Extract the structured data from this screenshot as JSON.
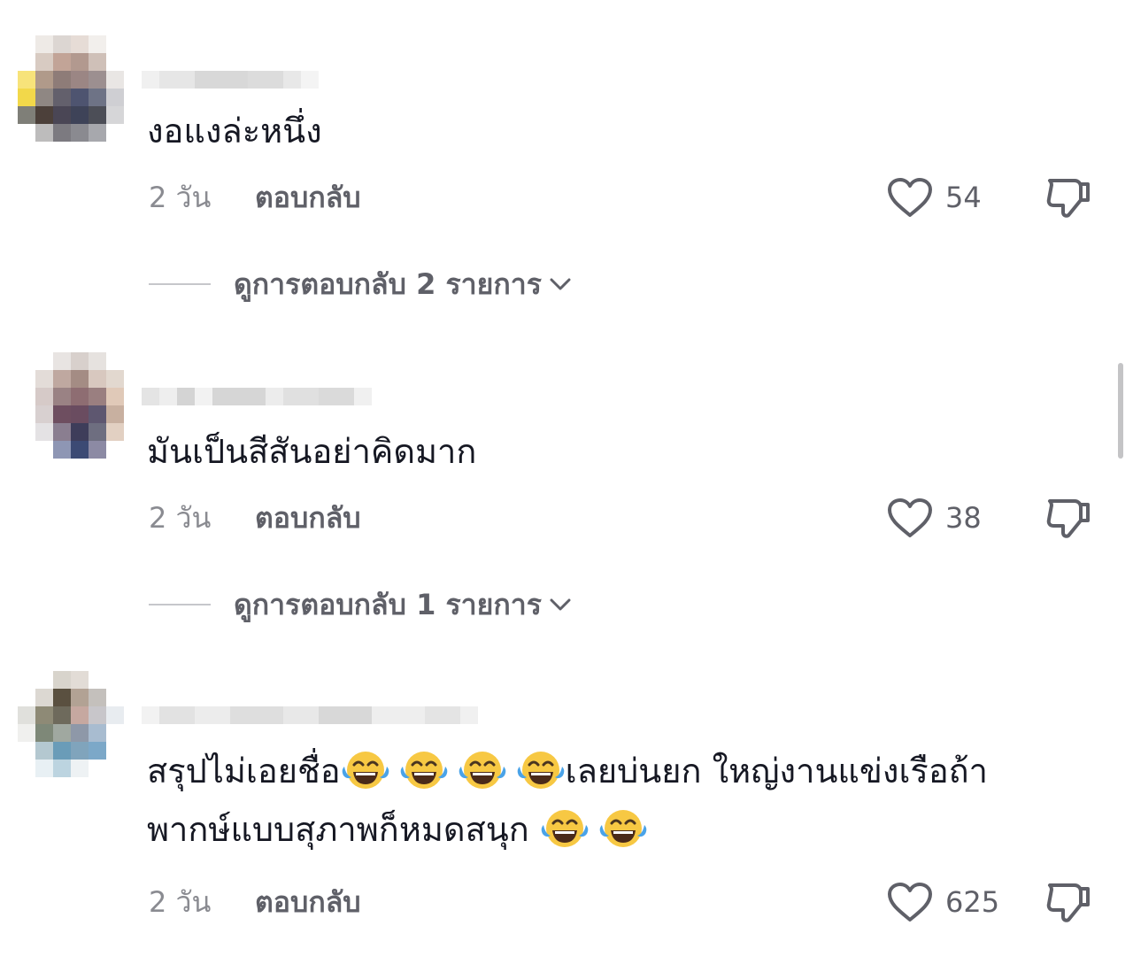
{
  "comments": [
    {
      "text": "งอแงล่ะหนึ่ง",
      "time": "2 วัน",
      "reply_label": "ตอบกลับ",
      "likes": "54",
      "view_replies": "ดูการตอบกลับ 2 รายการ"
    },
    {
      "text": "มันเป็นสีสันอย่าคิดมาก",
      "time": "2 วัน",
      "reply_label": "ตอบกลับ",
      "likes": "38",
      "view_replies": "ดูการตอบกลับ 1 รายการ"
    },
    {
      "text_part1": "สรุปไม่เอยชื่อ",
      "text_part2": "เลยบ่นยก ใหญ่งานแข่งเรือถ้า",
      "text_part3": "พากษ์แบบสุภาพก็หมดสนุก ",
      "time": "2 วัน",
      "reply_label": "ตอบกลับ",
      "likes": "625"
    }
  ],
  "icons": {
    "like": "heart-outline-icon",
    "dislike": "thumbs-down-icon",
    "expand": "chevron-down-icon",
    "emoji": "face-with-tears-of-joy-emoji"
  },
  "colors": {
    "text": "#161823",
    "secondary": "#5f6068",
    "muted": "#8a8b91",
    "divider": "#c6c7cb"
  }
}
